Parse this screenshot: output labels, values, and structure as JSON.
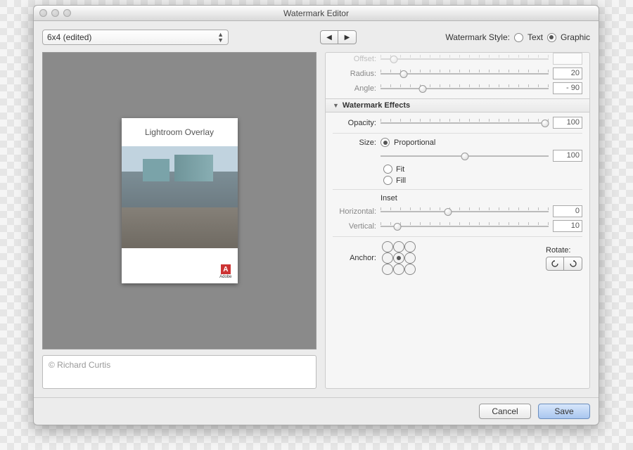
{
  "window": {
    "title": "Watermark Editor"
  },
  "preset": {
    "selected": "6x4 (edited)"
  },
  "style": {
    "label": "Watermark Style:",
    "text": "Text",
    "graphic": "Graphic",
    "selected": "graphic"
  },
  "preview": {
    "overlay_text": "Lightroom Overlay",
    "logo_label": "Adobe",
    "logo_letter": "A"
  },
  "copyright": {
    "text": "© Richard Curtis"
  },
  "shadow": {
    "offset_label": "Offset:",
    "radius_label": "Radius:",
    "radius_value": "20",
    "angle_label": "Angle:",
    "angle_value": "- 90"
  },
  "effects": {
    "section_title": "Watermark Effects",
    "opacity_label": "Opacity:",
    "opacity_value": "100",
    "size_label": "Size:",
    "size_proportional": "Proportional",
    "size_fit": "Fit",
    "size_fill": "Fill",
    "size_value": "100",
    "inset_label": "Inset",
    "horizontal_label": "Horizontal:",
    "horizontal_value": "0",
    "vertical_label": "Vertical:",
    "vertical_value": "10",
    "anchor_label": "Anchor:",
    "rotate_label": "Rotate:"
  },
  "buttons": {
    "cancel": "Cancel",
    "save": "Save"
  }
}
